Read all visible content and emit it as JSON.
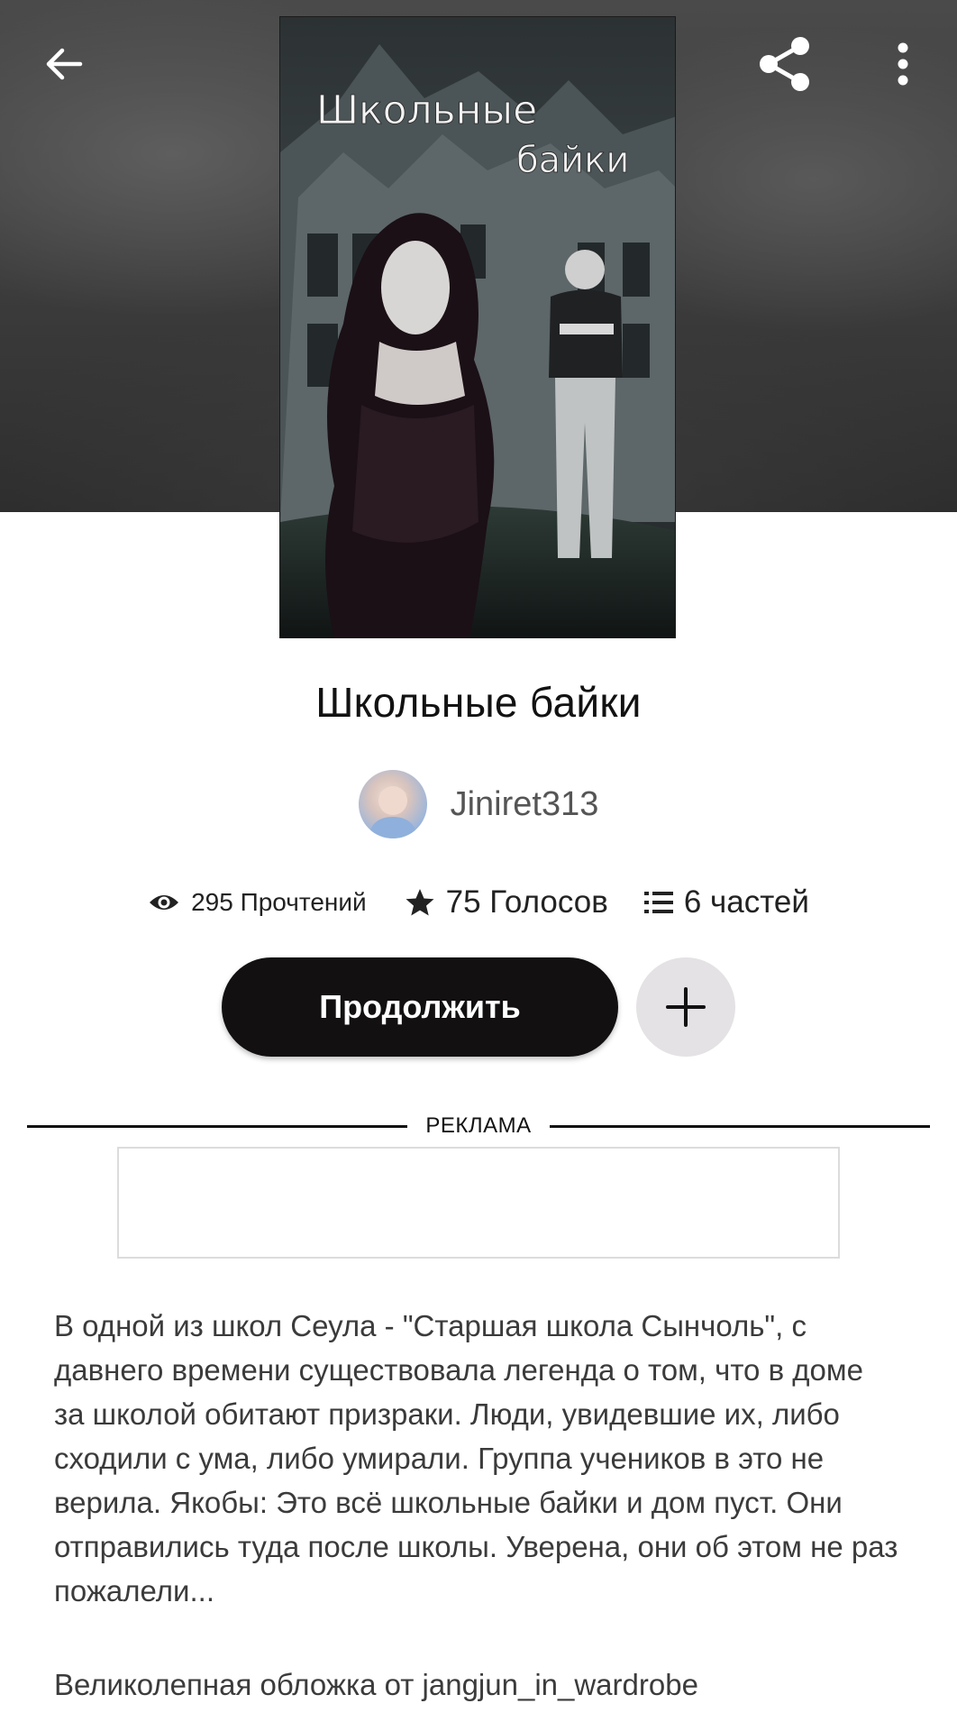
{
  "header": {
    "back_icon": "arrow-left-icon",
    "share_icon": "share-icon",
    "more_icon": "more-vertical-icon"
  },
  "cover": {
    "title_line1": "Школьные",
    "title_line2": "байки"
  },
  "story": {
    "title": "Школьные байки",
    "author": "Jiniret313"
  },
  "stats": {
    "reads": "295 Прочтений",
    "votes": "75 Голосов",
    "parts": "6 частей"
  },
  "actions": {
    "continue_label": "Продолжить",
    "add_icon": "plus-icon"
  },
  "ad": {
    "label": "РЕКЛАМА"
  },
  "description": {
    "text": "В одной из школ Сеула - \"Старшая школа Сынчоль\", с давнего времени существовала легенда о том, что в доме за школой обитают призраки. Люди, увидевшие их, либо сходили с ума, либо умирали. Группа учеников в это не верила. Якобы: Это всё школьные байки и дом пуст. Они отправились туда после школы. Уверена, они об этом не раз пожалели...",
    "credit": "Великолепная обложка от jangjun_in_wardrobe"
  },
  "colors": {
    "primary_button": "#121010",
    "add_button_bg": "#e4e2e4",
    "text": "#121212",
    "muted_text": "#555555"
  }
}
